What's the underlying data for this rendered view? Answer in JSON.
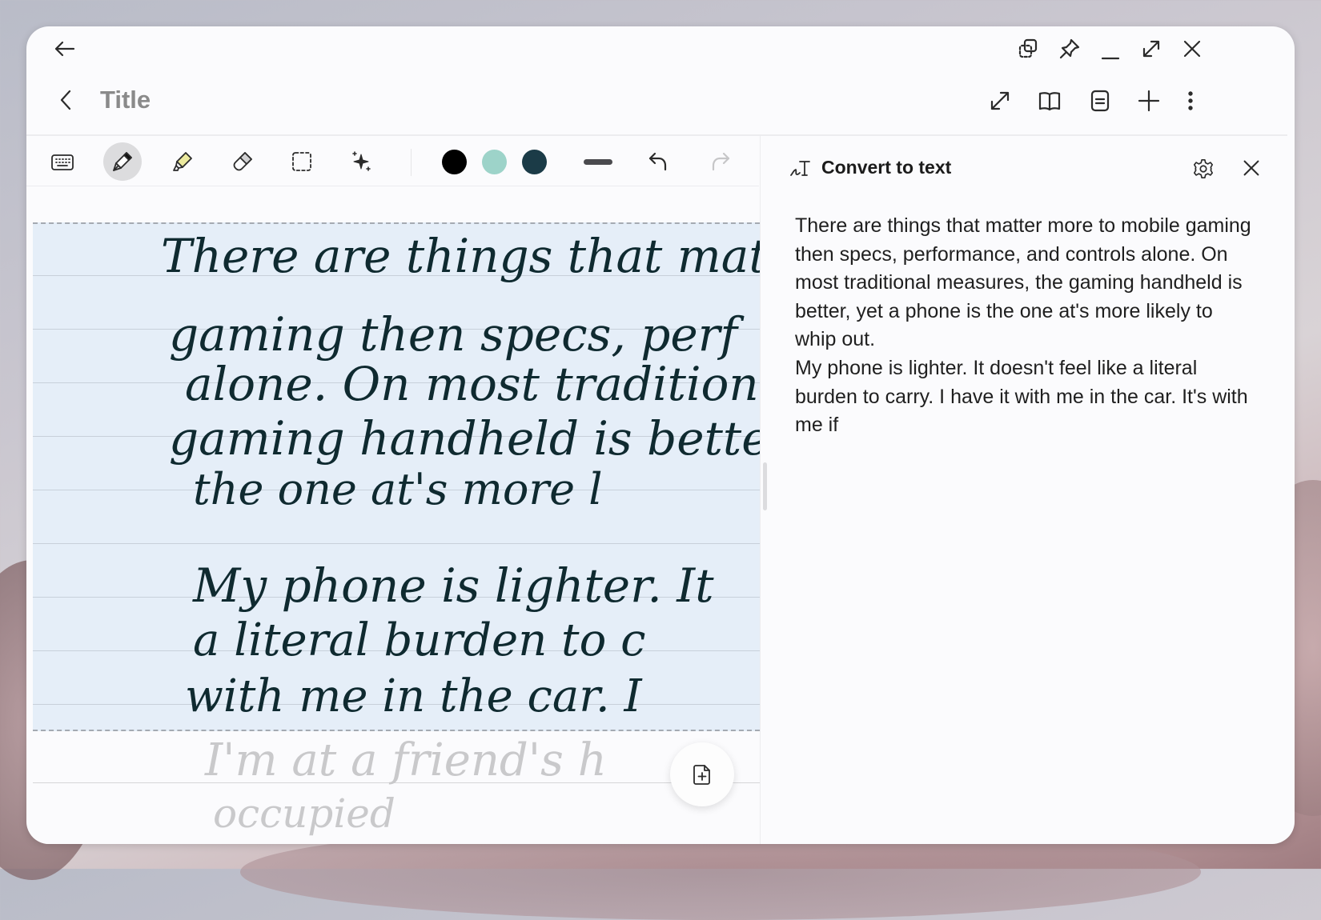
{
  "window": {
    "title": "Title",
    "caption_buttons": [
      "split-screen",
      "pin",
      "minimize",
      "maximize",
      "close"
    ]
  },
  "header": {
    "actions": [
      "resize",
      "book-view",
      "page-view",
      "add",
      "more-options"
    ]
  },
  "toolbar": {
    "tools": [
      "keyboard",
      "pen",
      "highlighter",
      "eraser",
      "lasso-select",
      "ai-assist"
    ],
    "active_tool": "pen",
    "colors": [
      "#000000",
      "#9dd3c9",
      "#1b3b47"
    ],
    "stroke": "thick",
    "undo": "undo",
    "redo": "redo"
  },
  "note": {
    "handwriting_lines": [
      "There are things that matter",
      "gaming then specs, perf",
      "alone. On most tradition",
      "gaming handheld is bette",
      "the one at's more l",
      "My phone is lighter. It",
      "a literal burden to c",
      "with me in the car. I",
      "I'm at a friend's h",
      "occupied"
    ]
  },
  "convert_panel": {
    "title": "Convert to text",
    "paragraphs": [
      "There are things that matter more to mobile gaming then specs, performance, and controls alone. On most traditional measures, the gaming handheld is better, yet a phone is the one at's more likely to whip out.",
      "My phone is lighter. It doesn't feel like a literal burden to carry. I have it with me in the car. It's with me if"
    ]
  }
}
